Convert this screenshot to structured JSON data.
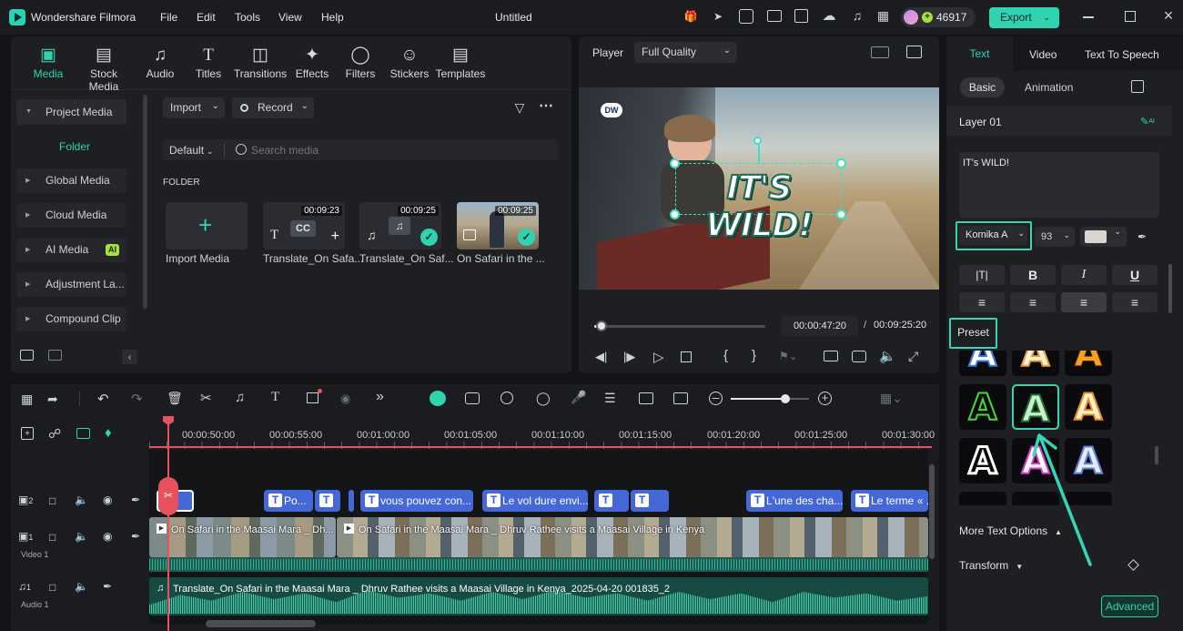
{
  "app": {
    "title": "Wondershare Filmora",
    "doc_title": "Untitled",
    "credits": "46917",
    "export_label": "Export"
  },
  "menu": [
    "File",
    "Edit",
    "Tools",
    "View",
    "Help"
  ],
  "toolbar": [
    "Media",
    "Stock Media",
    "Audio",
    "Titles",
    "Transitions",
    "Effects",
    "Filters",
    "Stickers",
    "Templates"
  ],
  "sidebar": {
    "project_media": "Project Media",
    "folder": "Folder",
    "items": [
      "Global Media",
      "Cloud Media",
      "AI Media",
      "Adjustment La...",
      "Compound Clip"
    ],
    "ai_badge": "AI"
  },
  "media": {
    "import_label": "Import",
    "record_label": "Record",
    "sort_label": "Default",
    "search_placeholder": "Search media",
    "folder_heading": "FOLDER",
    "import_media": "Import Media",
    "items": [
      {
        "name": "Translate_On Safa...",
        "duration": "00:09:23"
      },
      {
        "name": "Translate_On Saf...",
        "duration": "00:09:25"
      },
      {
        "name": "On Safari in the ...",
        "duration": "00:09:25"
      }
    ]
  },
  "player": {
    "label": "Player",
    "quality": "Full Quality",
    "current_time": "00:00:47:20",
    "separator": "/",
    "total_time": "00:09:25:20",
    "overlay_text": "IT'S WILD!",
    "logo": "DW",
    "progress": 0.04
  },
  "right_panel": {
    "tabs": [
      "Text",
      "Video",
      "Text To Speech"
    ],
    "subtabs": [
      "Basic",
      "Animation"
    ],
    "layer": "Layer 01",
    "text_value": "IT's WILD!",
    "font": "Komika A",
    "size": "93",
    "color": "#d9d6d1",
    "preset_label": "Preset",
    "more_options": "More Text Options",
    "transform": "Transform",
    "advanced": "Advanced",
    "format_bold": "B",
    "format_italic": "I",
    "format_underline": "U",
    "ai_suffix": "AI"
  },
  "timeline": {
    "ruler": [
      "00:00:50:00",
      "00:00:55:00",
      "00:01:00:00",
      "00:01:05:00",
      "00:01:10:00",
      "00:01:15:00",
      "00:01:20:00",
      "00:01:25:00",
      "00:01:30:00"
    ],
    "tracks": [
      {
        "num": "2",
        "name": ""
      },
      {
        "num": "1",
        "name": "Video 1"
      },
      {
        "num": "1",
        "name": "Audio 1"
      }
    ],
    "text_clips": [
      "Po...",
      "",
      "vous pouvez con...",
      "Le vol dure envi...",
      "",
      "",
      "L'une des cha...",
      "Le terme « ..."
    ],
    "video_clips": [
      "On Safari in the Maasai Mara _ Dh...",
      "On Safari in the Maasai Mara _ Dhruv Rathee visits a Maasai Village in Kenya"
    ],
    "audio_clip": "Translate_On Safari in the Maasai Mara _ Dhruv Rathee visits a Maasai Village in Kenya_2025-04-20 001835_2",
    "zoom": 0.7
  },
  "colors": {
    "accent": "#2fd3b0",
    "text_clip": "#4568d9",
    "playhead": "#e8525c"
  }
}
